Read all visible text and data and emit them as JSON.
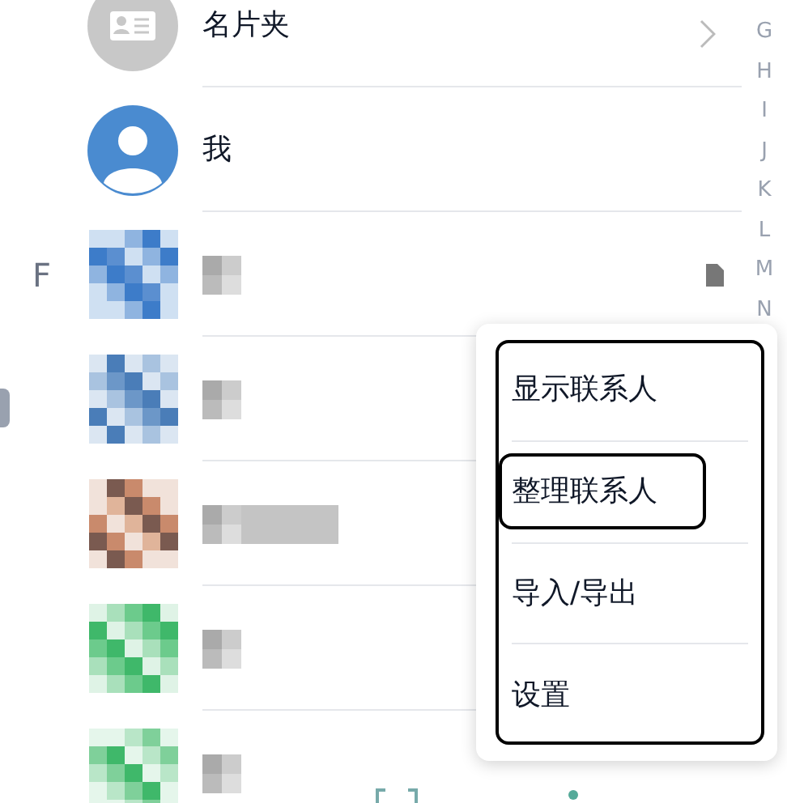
{
  "contacts": [
    {
      "kind": "card_holder",
      "name": "名片夹"
    },
    {
      "kind": "me",
      "name": "我"
    },
    {
      "kind": "pixelated",
      "section": "F",
      "sim": true
    },
    {
      "kind": "pixelated"
    },
    {
      "kind": "pixelated"
    },
    {
      "kind": "pixelated"
    },
    {
      "kind": "pixelated"
    }
  ],
  "index_letters": [
    "G",
    "H",
    "I",
    "J",
    "K",
    "L",
    "M",
    "N"
  ],
  "menu": {
    "items": [
      {
        "label": "显示联系人",
        "highlighted": false
      },
      {
        "label": "整理联系人",
        "highlighted": true
      },
      {
        "label": "导入/导出",
        "highlighted": false
      },
      {
        "label": "设置",
        "highlighted": false
      }
    ]
  }
}
